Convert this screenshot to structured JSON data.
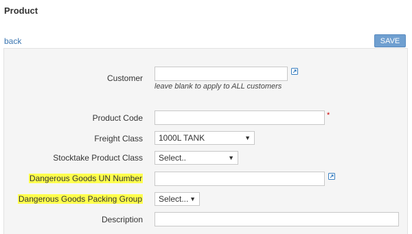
{
  "page": {
    "title": "Product",
    "back_label": "back",
    "save_label": "SAVE"
  },
  "form": {
    "customer": {
      "label": "Customer",
      "value": "",
      "hint": "leave blank to apply to ALL customers",
      "link_icon": "external-link-icon"
    },
    "product_code": {
      "label": "Product Code",
      "value": "",
      "required_mark": "*"
    },
    "freight_class": {
      "label": "Freight Class",
      "selected": "1000L TANK"
    },
    "stocktake_class": {
      "label": "Stocktake Product Class",
      "selected": "Select.."
    },
    "dg_un_number": {
      "label": "Dangerous Goods UN Number",
      "value": "",
      "highlighted": true,
      "link_icon": "external-link-icon"
    },
    "dg_packing_group": {
      "label": "Dangerous Goods Packing Group",
      "selected": "Select...",
      "highlighted": true
    },
    "description": {
      "label": "Description",
      "value": ""
    }
  },
  "colors": {
    "highlight": "#ffff4d",
    "save_button": "#6f9fd0",
    "link": "#3a75b0",
    "icon": "#3a7fc0",
    "required": "#cc0000"
  }
}
